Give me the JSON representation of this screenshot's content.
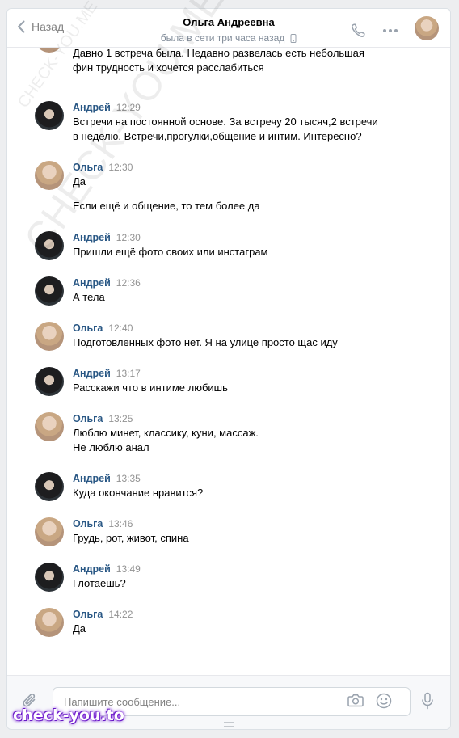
{
  "header": {
    "back_label": "Назад",
    "peer_name": "Ольга Андреевна",
    "peer_status": "была в сети три часа назад"
  },
  "messages": [
    {
      "author": "",
      "time": "",
      "avatar": "female",
      "lines": [
        "Давно 1 встреча была. Недавно развелась есть небольшая",
        "фин трудность и хочется расслабиться"
      ]
    },
    {
      "author": "Андрей",
      "time": "12:29",
      "avatar": "male",
      "lines": [
        "Встречи на постоянной основе. За встречу 20 тысяч,2 встречи",
        "в неделю. Встречи,прогулки,общение и интим. Интересно?"
      ]
    },
    {
      "author": "Ольга",
      "time": "12:30",
      "avatar": "female",
      "lines": [
        "Да",
        "",
        "Если ещё и общение, то тем более да"
      ]
    },
    {
      "author": "Андрей",
      "time": "12:30",
      "avatar": "male",
      "lines": [
        "Пришли ещё фото своих или инстаграм"
      ]
    },
    {
      "author": "Андрей",
      "time": "12:36",
      "avatar": "male",
      "lines": [
        "А тела"
      ]
    },
    {
      "author": "Ольга",
      "time": "12:40",
      "avatar": "female",
      "lines": [
        "Подготовленных фото нет. Я на улице просто щас иду"
      ]
    },
    {
      "author": "Андрей",
      "time": "13:17",
      "avatar": "male",
      "lines": [
        "Расскажи что в интиме любишь"
      ]
    },
    {
      "author": "Ольга",
      "time": "13:25",
      "avatar": "female",
      "lines": [
        "Люблю минет, классику, куни, массаж.",
        "Не люблю анал"
      ]
    },
    {
      "author": "Андрей",
      "time": "13:35",
      "avatar": "male",
      "lines": [
        "Куда окончание нравится?"
      ]
    },
    {
      "author": "Ольга",
      "time": "13:46",
      "avatar": "female",
      "lines": [
        "Грудь, рот, живот, спина"
      ]
    },
    {
      "author": "Андрей",
      "time": "13:49",
      "avatar": "male",
      "lines": [
        "Глотаешь?"
      ]
    },
    {
      "author": "Ольга",
      "time": "14:22",
      "avatar": "female",
      "lines": [
        "Да"
      ]
    }
  ],
  "composer": {
    "placeholder": "Напишите сообщение..."
  },
  "watermarks": {
    "diagonal_big": "CHECK-YOU.ME",
    "diagonal_small": "CHECK-YOU.ME",
    "logo": "check-you.to"
  },
  "colors": {
    "author_link": "#2a5885",
    "time": "#939393",
    "status": "#818c99",
    "accent_icons": "#99a2ad"
  }
}
